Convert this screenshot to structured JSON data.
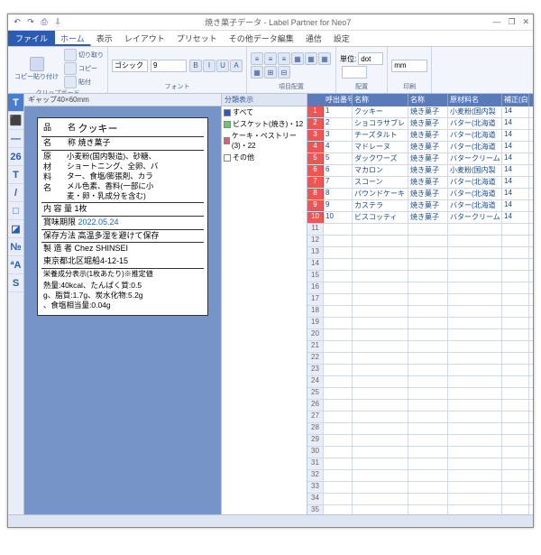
{
  "window": {
    "title": "焼き菓子データ - Label Partner for Neo7"
  },
  "qat": [
    "↶",
    "↷",
    "⎙",
    "⇩"
  ],
  "tabs": {
    "file": "ファイル",
    "items": [
      "ホーム",
      "表示",
      "レイアウト",
      "プリセット",
      "その他データ編集",
      "通信",
      "設定"
    ],
    "active": 0
  },
  "ribbon": {
    "groups": [
      {
        "label": "クリップボード",
        "big": [
          {
            "t": "コピー貼り付け"
          }
        ],
        "small": [
          "切り取り",
          "コピー",
          "貼付"
        ]
      },
      {
        "label": "フォント",
        "combos": [
          "ゴシック",
          "9"
        ],
        "btns": [
          "B",
          "I",
          "U",
          "A"
        ]
      },
      {
        "label": "項目配置",
        "btns": [
          "≡",
          "≡",
          "≡",
          "▦",
          "▦",
          "▦",
          "▦",
          "⊞",
          "⊟"
        ]
      },
      {
        "label": "配置",
        "rows": [
          [
            "単位:",
            "dot"
          ],
          [
            "",
            ""
          ]
        ]
      },
      {
        "label": "印刷",
        "combos": [
          "mm"
        ]
      }
    ]
  },
  "tools": [
    "T",
    "⬛",
    "—",
    "26",
    "T",
    "/",
    "□",
    "◪",
    "№",
    "ªA",
    "S"
  ],
  "design": {
    "hdr": "ギャップ40×60mm"
  },
  "label": {
    "r1": {
      "k": "品　　名 ",
      "v": "クッキー"
    },
    "r2": {
      "k": "名　　称 ",
      "v": "焼き菓子"
    },
    "ing_k": "原　材\n料　名",
    "ing_v": "小麦粉(国内製造)、砂糖、\nショートニング、全卵、バ\nター、食塩/膨張剤、カラ\nメル色素、香料(一部に小\n麦・卵・乳成分を含む)",
    "qty": {
      "k": "内 容 量 ",
      "v": "1枚"
    },
    "exp": {
      "k": "賞味期限 ",
      "v": "2022.05.24"
    },
    "store": {
      "k": "保存方法 ",
      "v": "高温多湿を避けて保存"
    },
    "mfr": {
      "k": "製 造 者 ",
      "v": "Chez SHINSEI"
    },
    "addr": "東京都北区堀船4-12-15",
    "nut_h": "栄養成分表示(1枚あたり)※推定値",
    "nut_b": "熱量:40kcal、たんぱく質:0.5\ng、脂質:1.7g、炭水化物:5.2g\n、食塩相当量:0.04g"
  },
  "categ": {
    "hdr": "分類表示",
    "items": [
      {
        "c": "#3355cc",
        "t": "すべて"
      },
      {
        "c": "#66cc66",
        "t": "ビスケット(焼き)・12"
      },
      {
        "c": "#ee5577",
        "t": "ケーキ・ペストリー(3)・22"
      },
      {
        "c": "#ffffff",
        "t": "その他"
      }
    ]
  },
  "grid": {
    "cols": [
      "呼出番号",
      "名称",
      "名称",
      "原材料名",
      "補正(白)"
    ],
    "rows": [
      [
        "1",
        "クッキー",
        "焼き菓子",
        "小麦粉(国内製",
        "14"
      ],
      [
        "2",
        "ショコラサブレ",
        "焼き菓子",
        "バター(北海道",
        "14"
      ],
      [
        "3",
        "チーズタルト",
        "焼き菓子",
        "バター(北海道",
        "14"
      ],
      [
        "4",
        "マドレーヌ",
        "焼き菓子",
        "バター(北海道",
        "14"
      ],
      [
        "5",
        "ダックワーズ",
        "焼き菓子",
        "バタークリーム",
        "14"
      ],
      [
        "6",
        "マカロン",
        "焼き菓子",
        "小麦粉(国内製",
        "14"
      ],
      [
        "7",
        "スコーン",
        "焼き菓子",
        "バター(北海道",
        "14"
      ],
      [
        "8",
        "パウンドケーキ",
        "焼き菓子",
        "バター(北海道",
        "14"
      ],
      [
        "9",
        "カステラ",
        "焼き菓子",
        "バター(北海道",
        "14"
      ],
      [
        "10",
        "ビスコッティ",
        "焼き菓子",
        "バタークリーム",
        "14"
      ]
    ],
    "empty": 25
  }
}
